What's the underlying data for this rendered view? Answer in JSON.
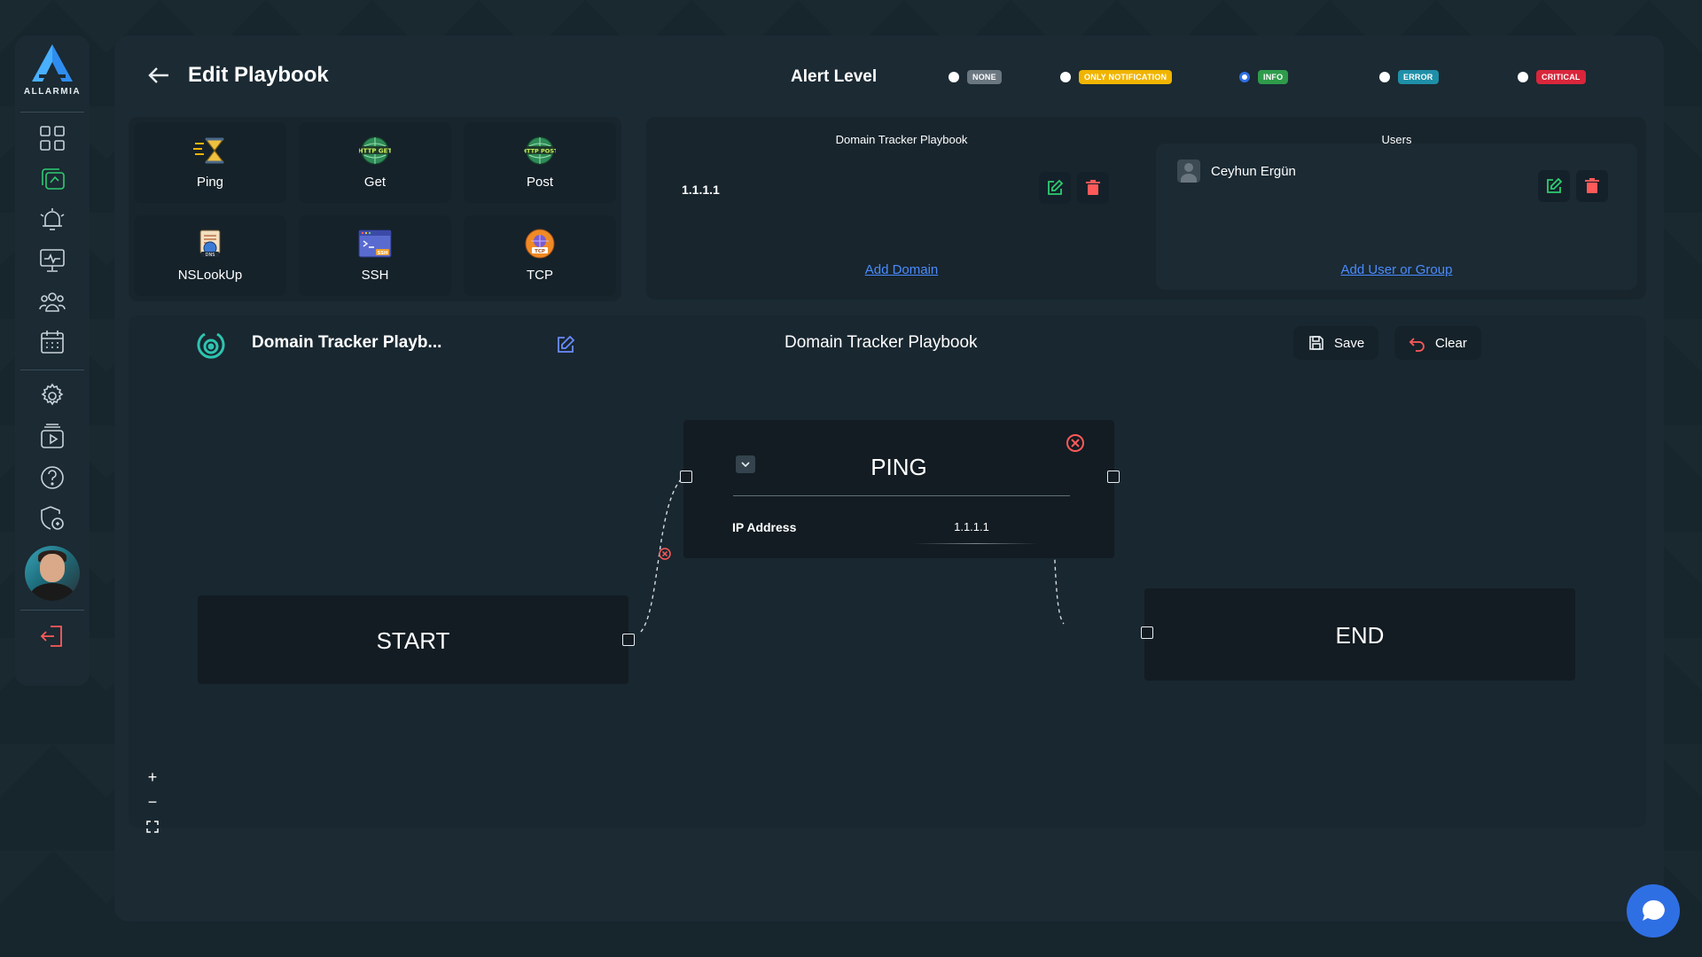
{
  "app": {
    "logo_text": "ALLARMIA"
  },
  "sidebar": {
    "items": [
      {
        "name": "dashboard-icon"
      },
      {
        "name": "playbooks-icon"
      },
      {
        "name": "alarm-bell-icon"
      },
      {
        "name": "monitor-icon"
      },
      {
        "name": "users-icon"
      },
      {
        "name": "calendar-icon"
      },
      {
        "name": "settings-gear-icon"
      },
      {
        "name": "media-play-icon"
      },
      {
        "name": "help-icon"
      },
      {
        "name": "security-shield-icon"
      },
      {
        "name": "logout-icon"
      }
    ]
  },
  "header": {
    "title": "Edit Playbook"
  },
  "alert_level": {
    "title": "Alert Level",
    "options": [
      {
        "label": "NONE",
        "color": "#6b7780",
        "selected": false
      },
      {
        "label": "ONLY NOTIFICATION",
        "color": "#f0b400",
        "selected": false
      },
      {
        "label": "INFO",
        "color": "#2e9b4a",
        "selected": true
      },
      {
        "label": "ERROR",
        "color": "#1f8fa8",
        "selected": false
      },
      {
        "label": "CRITICAL",
        "color": "#d9263b",
        "selected": false
      }
    ]
  },
  "toolbox": {
    "tools": [
      {
        "label": "Ping",
        "icon": "ping-icon"
      },
      {
        "label": "Get",
        "icon": "http-get-icon"
      },
      {
        "label": "Post",
        "icon": "http-post-icon"
      },
      {
        "label": "NSLookUp",
        "icon": "nslookup-icon"
      },
      {
        "label": "SSH",
        "icon": "ssh-icon"
      },
      {
        "label": "TCP",
        "icon": "tcp-icon"
      }
    ]
  },
  "domain_panel": {
    "title": "Domain Tracker Playbook",
    "domain": "1.1.1.1",
    "add_label": "Add Domain"
  },
  "users_panel": {
    "title": "Users",
    "user_name": "Ceyhun Ergün",
    "add_label": "Add User or Group"
  },
  "canvas": {
    "playbook_name": "Domain Tracker Playb...",
    "playbook_title": "Domain Tracker Playbook",
    "save_label": "Save",
    "clear_label": "Clear",
    "nodes": {
      "start": "START",
      "end": "END",
      "ping": {
        "title": "PING",
        "field_label": "IP Address",
        "field_value": "1.1.1.1"
      }
    },
    "zoom_in": "+",
    "zoom_out": "−"
  },
  "colors": {
    "accent": "#2f6fe4",
    "edit_green": "#2ecc71",
    "delete_red": "#ff5a5a",
    "link_blue": "#4a8cff"
  }
}
